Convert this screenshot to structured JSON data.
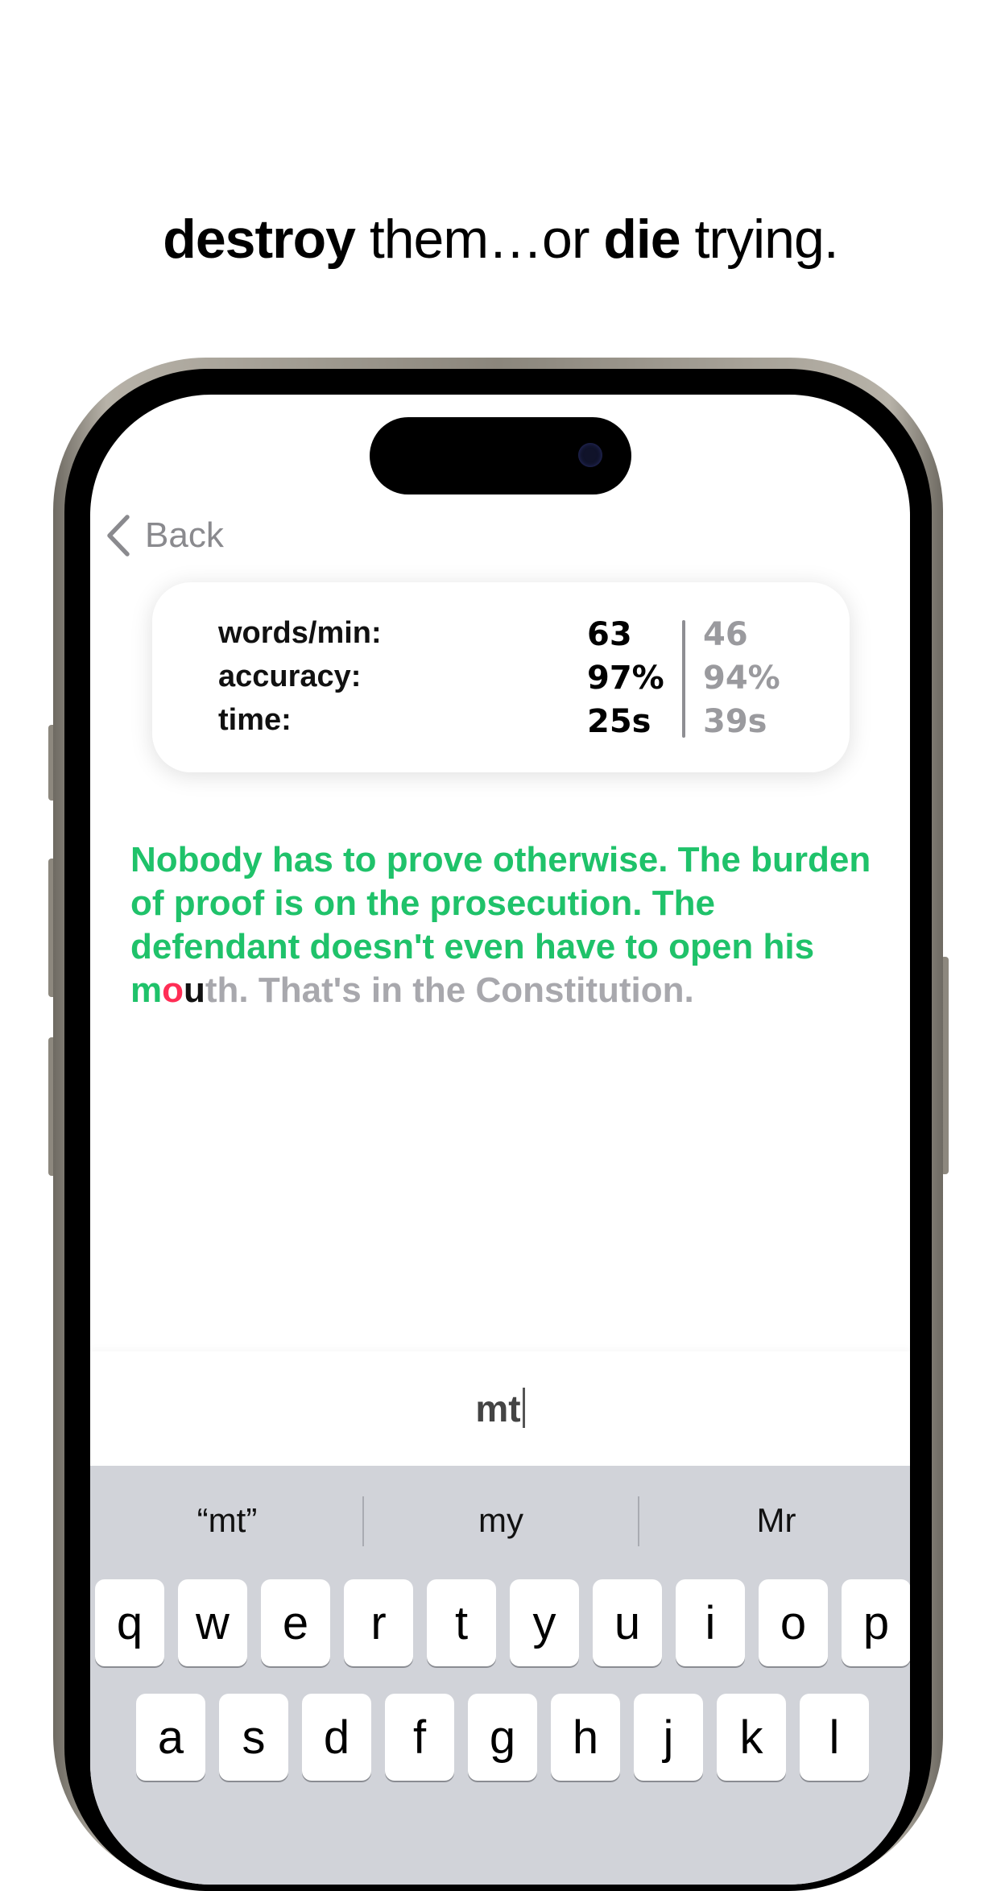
{
  "headline": {
    "bold1": "destroy",
    "text1": " them…or ",
    "bold2": "die",
    "text2": " trying."
  },
  "nav": {
    "back_label": "Back"
  },
  "stats": {
    "labels": [
      "words/min:",
      "accuracy:",
      "time:"
    ],
    "current": [
      "63",
      "97%",
      "25s"
    ],
    "previous": [
      "46",
      "94%",
      "39s"
    ]
  },
  "passage": {
    "typed": "Nobody has to prove otherwise. The burden of proof is on the prosecution. The defendant doesn't even have to open his m",
    "error_char": "o",
    "cursor_char": "u",
    "remaining": "th. That's in the Constitution."
  },
  "input": {
    "value": "mt"
  },
  "keyboard": {
    "suggestions": [
      "“mt”",
      "my",
      "Mr"
    ],
    "row1": [
      "q",
      "w",
      "e",
      "r",
      "t",
      "y",
      "u",
      "i",
      "o",
      "p"
    ],
    "row2": [
      "a",
      "s",
      "d",
      "f",
      "g",
      "h",
      "j",
      "k",
      "l"
    ]
  },
  "colors": {
    "correct": "#1fc26a",
    "error": "#ff2d55",
    "pending": "#a8a8ad"
  }
}
